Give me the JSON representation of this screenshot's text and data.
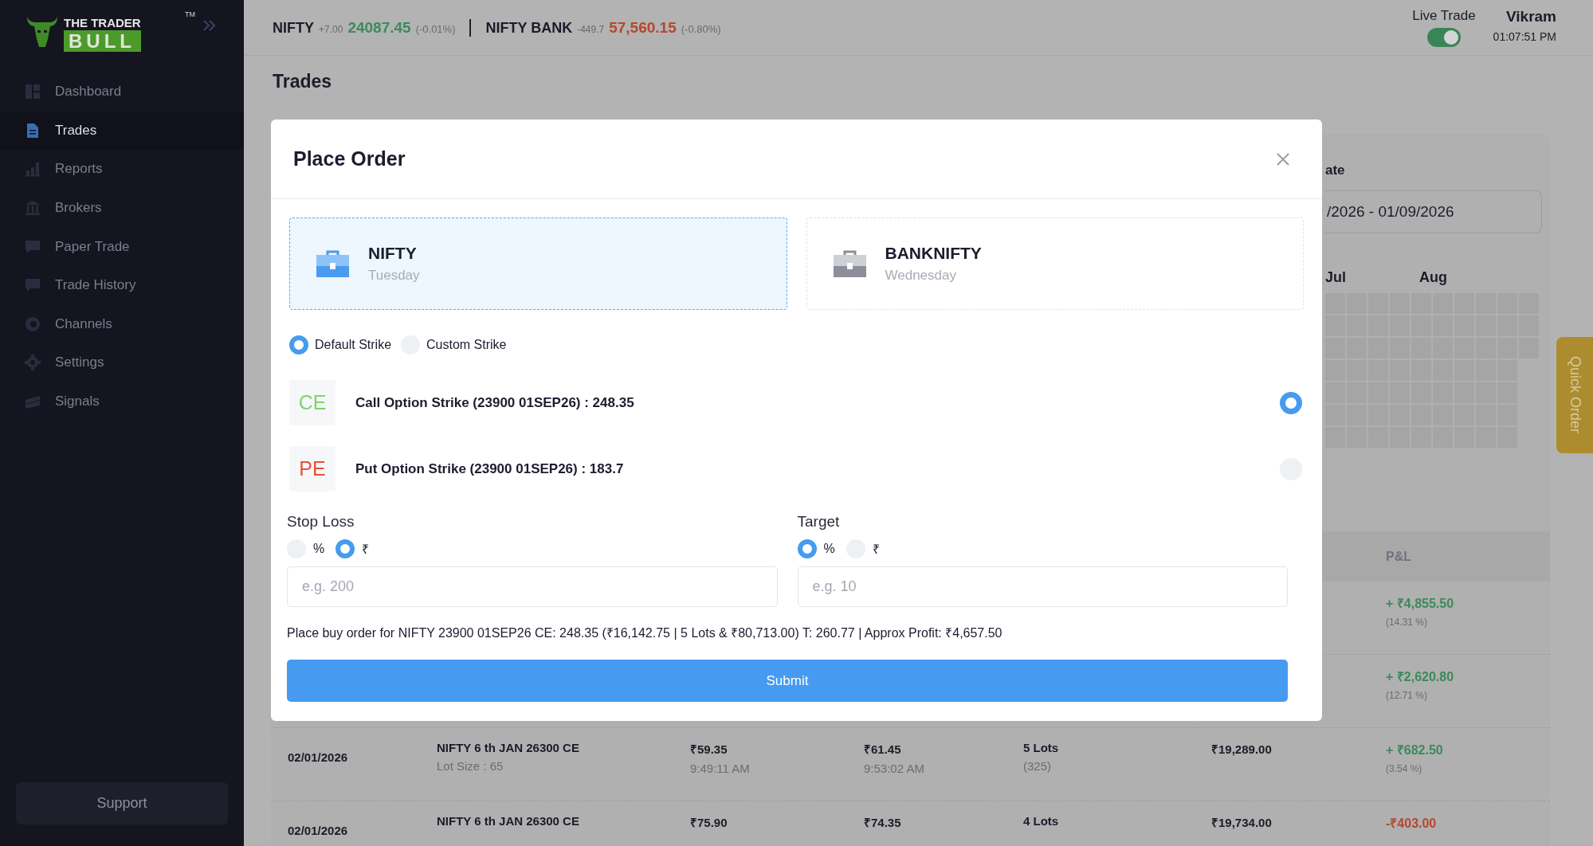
{
  "sidebar": {
    "logo": {
      "line1": "THE TRADER",
      "line2": "BULL",
      "mark": "TM"
    },
    "items": [
      {
        "label": "Dashboard",
        "selected": false
      },
      {
        "label": "Trades",
        "selected": true
      },
      {
        "label": "Reports",
        "selected": false
      },
      {
        "label": "Brokers",
        "selected": false
      },
      {
        "label": "Paper Trade",
        "selected": false
      },
      {
        "label": "Trade History",
        "selected": false
      },
      {
        "label": "Channels",
        "selected": false
      },
      {
        "label": "Settings",
        "selected": false
      },
      {
        "label": "Signals",
        "selected": false
      }
    ],
    "support": "Support"
  },
  "topbar": {
    "indices": [
      {
        "name": "NIFTY",
        "change": "+7.00",
        "value": "24087.45",
        "percent": "(-0.01%)",
        "kind": "up"
      },
      {
        "name": "NIFTY BANK",
        "change": "-449.7",
        "value": "57,560.15",
        "percent": "(-0.80%)",
        "kind": "down"
      }
    ],
    "live_trade": {
      "label": "Live Trade",
      "on": true
    },
    "user": "Vikram",
    "time": "01:07:51 PM"
  },
  "page_title": "Trades",
  "filters": {
    "date_label": "ate",
    "date_value": "/2026 - 01/09/2026"
  },
  "heatmap": {
    "months": [
      "Jul",
      "Aug"
    ]
  },
  "table": {
    "pnl_column": "P&L",
    "rows": [
      {
        "kind": "profit",
        "pnl": "+ ₹4,855.50",
        "pnl_percent": "(14.31 %)"
      },
      {
        "kind": "profit",
        "pnl": "+ ₹2,620.80",
        "pnl_percent": "(12.71 %)"
      },
      {
        "kind": "profit",
        "date": "02/01/2026",
        "instrument": "NIFTY 6 th JAN 26300 CE",
        "lot_size": "Lot Size : 65",
        "entry_price": "₹59.35",
        "entry_time": "9:49:11 AM",
        "exit_price": "₹61.45",
        "exit_time": "9:53:02 AM",
        "lots": "5 Lots",
        "quantity": "(325)",
        "value": "₹19,289.00",
        "pnl": "+ ₹682.50",
        "pnl_percent": "(3.54 %)"
      },
      {
        "kind": "loss",
        "date": "02/01/2026",
        "instrument": "NIFTY 6 th JAN 26300 CE",
        "entry_price": "₹75.90",
        "exit_price": "₹74.35",
        "lots": "4 Lots",
        "value": "₹19,734.00",
        "pnl": "-₹403.00"
      }
    ]
  },
  "quick_order": "Quick Order",
  "modal": {
    "title": "Place Order",
    "indices": [
      {
        "name": "NIFTY",
        "day": "Tuesday",
        "selected": true
      },
      {
        "name": "BANKNIFTY",
        "day": "Wednesday",
        "selected": false
      }
    ],
    "strike_modes": [
      {
        "label": "Default Strike",
        "selected": true
      },
      {
        "label": "Custom Strike",
        "selected": false
      }
    ],
    "strikes": [
      {
        "tag": "CE",
        "kind": "call",
        "label": "Call Option Strike (23900 01SEP26) : 248.35",
        "selected": true
      },
      {
        "tag": "PE",
        "kind": "put",
        "label": "Put Option Strike (23900 01SEP26) : 183.7",
        "selected": false
      }
    ],
    "stop_loss": {
      "label": "Stop Loss",
      "units": [
        {
          "label": "%",
          "selected": false
        },
        {
          "label": "₹",
          "selected": true
        }
      ],
      "placeholder": "e.g. 200"
    },
    "target": {
      "label": "Target",
      "units": [
        {
          "label": "%",
          "selected": true
        },
        {
          "label": "₹",
          "selected": false
        }
      ],
      "placeholder": "e.g. 10"
    },
    "summary": "Place buy order for NIFTY 23900 01SEP26 CE: 248.35 (₹16,142.75 | 5 Lots & ₹80,713.00) T: 260.77 | Approx Profit: ₹4,657.50",
    "submit": "Submit"
  }
}
